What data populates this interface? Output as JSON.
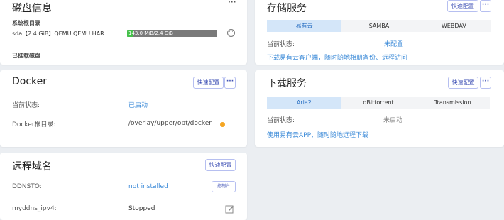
{
  "disk": {
    "title": "磁盘信息",
    "more": "···",
    "system_root_label": "系统根目录",
    "device": "sda【2.4 GiB】QEMU QEMU HAR...",
    "usage": "143.0 MiB/2.4 GiB",
    "usage_fraction": 0.06,
    "mounted_label": "已挂载磁盘"
  },
  "storage": {
    "title": "存储服务",
    "config_button": "快速配置",
    "more_button": "···",
    "tabs": [
      "易有云",
      "SAMBA",
      "WEBDAV"
    ],
    "status_label": "当前状态:",
    "status_value": "未配置",
    "download_link": "下载易有云客户端，随时随地相册备份、远程访问"
  },
  "docker": {
    "title": "Docker",
    "config_button": "快速配置",
    "more_button": "···",
    "status_label": "当前状态:",
    "status_value": "已启动",
    "root_label": "Docker根目录:",
    "root_value": "/overlay/upper/opt/docker",
    "warning_color": "#f5a623"
  },
  "download": {
    "title": "下载服务",
    "config_button": "快速配置",
    "more_button": "···",
    "tabs": [
      "Aria2",
      "qBittorrent",
      "Transmission"
    ],
    "status_label": "当前状态:",
    "status_value": "未启动",
    "app_link": "使用易有云APP，随时随地远程下载"
  },
  "remote": {
    "title": "远程域名",
    "config_button": "快速配置",
    "ddnsto_label": "DDNSTO:",
    "ddnsto_status": "not installed",
    "console_button": "控制台",
    "myddns_label": "myddns_ipv4:",
    "myddns_status": "Stopped"
  }
}
